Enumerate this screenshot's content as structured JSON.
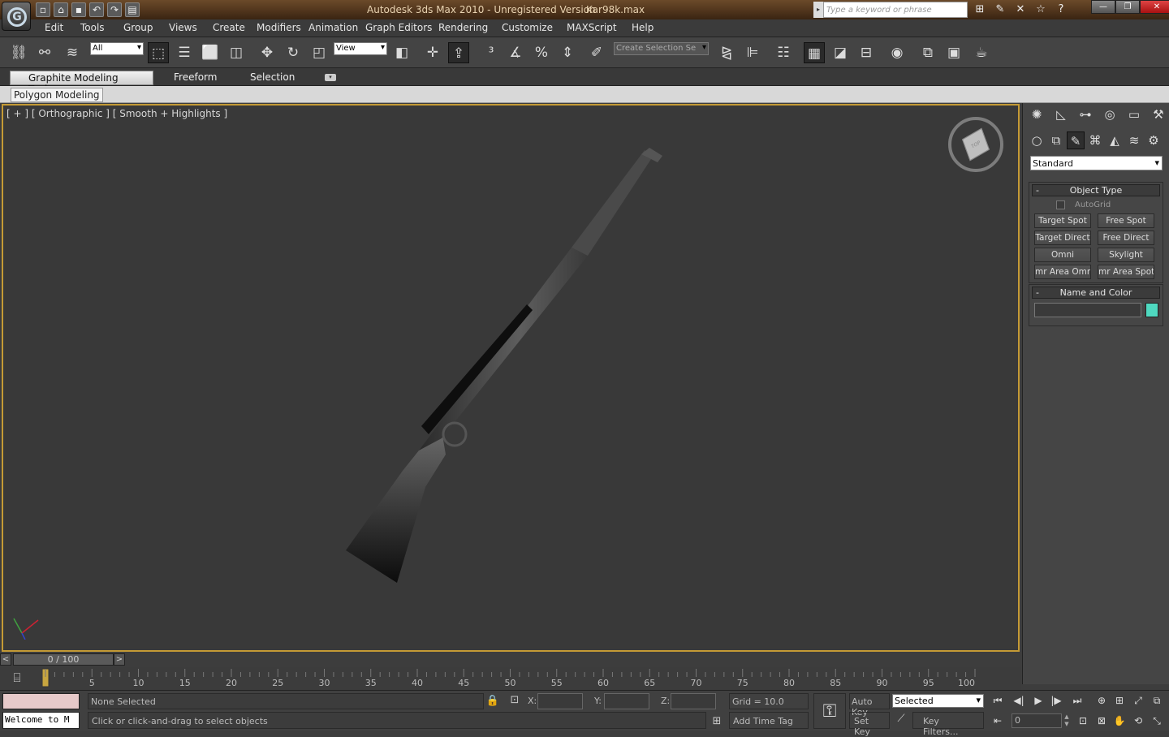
{
  "app": {
    "title": "Autodesk 3ds Max  2010    - Unregistered Version",
    "file": "Kar98k.max",
    "search_placeholder": "Type a keyword or phrase"
  },
  "quick_access": [
    "new-file",
    "open-file",
    "save-file",
    "undo",
    "redo",
    "project-folder"
  ],
  "menu": [
    "Edit",
    "Tools",
    "Group",
    "Views",
    "Create",
    "Modifiers",
    "Animation",
    "Graph Editors",
    "Rendering",
    "Customize",
    "MAXScript",
    "Help"
  ],
  "toolbar": {
    "filter_value": "All",
    "refcoord_value": "View",
    "selection_set_placeholder": "Create Selection Se"
  },
  "graphite": {
    "tabs": [
      "Graphite Modeling Tools",
      "Freeform",
      "Selection"
    ],
    "active_subtab": "Polygon Modeling"
  },
  "viewport": {
    "label": "[ + ] [ Orthographic ] [ Smooth + Highlights ]",
    "cube_face": "TOP"
  },
  "command_panel": {
    "category_value": "Standard",
    "object_type": {
      "title": "Object Type",
      "autogrid": "AutoGrid",
      "buttons": [
        "Target Spot",
        "Free Spot",
        "Target Direct",
        "Free Direct",
        "Omni",
        "Skylight",
        "mr Area Omni",
        "mr Area Spot"
      ]
    },
    "name_color": {
      "title": "Name and Color",
      "swatch": "#4fd9c0"
    }
  },
  "timeline": {
    "slider": "0 / 100",
    "ticks": [
      "5",
      "10",
      "15",
      "20",
      "25",
      "30",
      "35",
      "40",
      "45",
      "50",
      "55",
      "60",
      "65",
      "70",
      "75",
      "80",
      "85",
      "90",
      "95",
      "100"
    ]
  },
  "status": {
    "listener_output": "Welcome to M",
    "selection": "None Selected",
    "prompt": "Click or click-and-drag to select objects",
    "x_label": "X:",
    "y_label": "Y:",
    "z_label": "Z:",
    "grid": "Grid = 10.0",
    "add_time_tag": "Add Time Tag",
    "auto_key": "Auto Key",
    "set_key": "Set Key",
    "key_mode": "Selected",
    "key_filters": "Key Filters...",
    "frame": "0"
  }
}
